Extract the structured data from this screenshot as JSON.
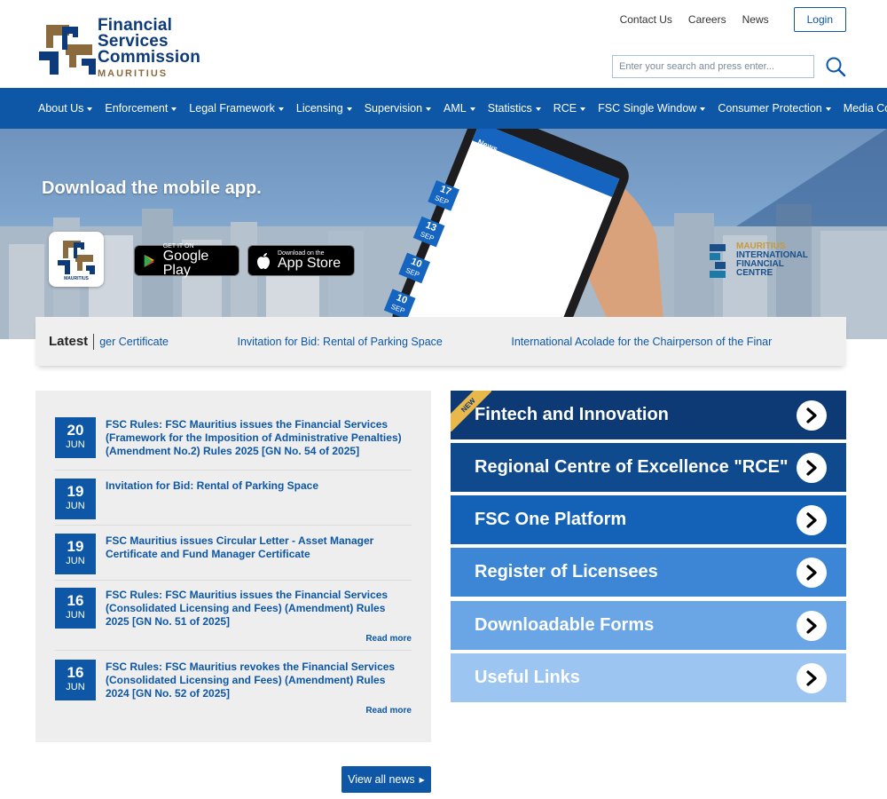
{
  "header": {
    "logo_lines": [
      "Financial",
      "Services",
      "Commission"
    ],
    "logo_sub": "MAURITIUS",
    "top_links": [
      "Contact Us",
      "Careers",
      "News"
    ],
    "login_label": "Login",
    "search_placeholder": "Enter your search and press enter..."
  },
  "nav": {
    "items": [
      "About Us",
      "Enforcement",
      "Legal Framework",
      "Licensing",
      "Supervision",
      "AML",
      "Statistics",
      "RCE",
      "FSC Single Window",
      "Consumer Protection",
      "Media Corner"
    ]
  },
  "hero": {
    "title": "Download the mobile app.",
    "badge_text": "MAURITIUS",
    "google_small": "GET IT ON",
    "google_big": "Google Play",
    "apple_small": "Download on the",
    "apple_big": "App Store",
    "mifc_lines": [
      "MAURITIUS",
      "INTERNATIONAL",
      "FINANCIAL",
      "CENTRE"
    ],
    "phone_header": "News",
    "phone_dates": [
      {
        "day": "17",
        "mon": "SEP"
      },
      {
        "day": "13",
        "mon": "SEP"
      },
      {
        "day": "10",
        "mon": "SEP"
      },
      {
        "day": "10",
        "mon": "SEP"
      }
    ]
  },
  "latest": {
    "label": "Latest",
    "items": [
      "ger Certificate",
      "Invitation for Bid: Rental of Parking Space",
      "International Acolade for the Chairperson of the Finar"
    ]
  },
  "news": [
    {
      "day": "20",
      "mon": "JUN",
      "title": "FSC Rules: FSC Mauritius issues the Financial Services (Framework for the Imposition of Administrative Penalties) (Amendment No.2) Rules 2025 [GN No. 54 of 2025]",
      "read_more": ""
    },
    {
      "day": "19",
      "mon": "JUN",
      "title": "Invitation for Bid: Rental of Parking Space",
      "read_more": ""
    },
    {
      "day": "19",
      "mon": "JUN",
      "title": "FSC Mauritius issues Circular Letter - Asset Manager Certificate and Fund Manager Certificate",
      "read_more": ""
    },
    {
      "day": "16",
      "mon": "JUN",
      "title": "FSC Rules: FSC Mauritius issues the Financial Services (Consolidated Licensing and Fees) (Amendment) Rules 2025 [GN No. 51 of 2025]",
      "read_more": "Read more"
    },
    {
      "day": "16",
      "mon": "JUN",
      "title": "FSC Rules: FSC Mauritius revokes the Financial Services (Consolidated Licensing and Fees) (Amendment) Rules 2024 [GN No. 52 of 2025]",
      "read_more": "Read more"
    }
  ],
  "view_all_label": "View all news",
  "tiles": [
    {
      "label": "Fintech and Innovation",
      "color": "#0d3a75",
      "badge": "NEW"
    },
    {
      "label": "Regional Centre of Excellence \"RCE\"",
      "color": "#0f4a8e",
      "badge": ""
    },
    {
      "label": "FSC One Platform",
      "color": "#1462b8",
      "badge": ""
    },
    {
      "label": "Register of Licensees",
      "color": "#3d86d6",
      "badge": ""
    },
    {
      "label": "Downloadable Forms",
      "color": "#6aa6e6",
      "badge": ""
    },
    {
      "label": "Useful Links",
      "color": "#9cc6f1",
      "badge": ""
    }
  ],
  "colors": {
    "brand_blue": "#0d57a6",
    "brand_gold": "#8b6a3e"
  }
}
